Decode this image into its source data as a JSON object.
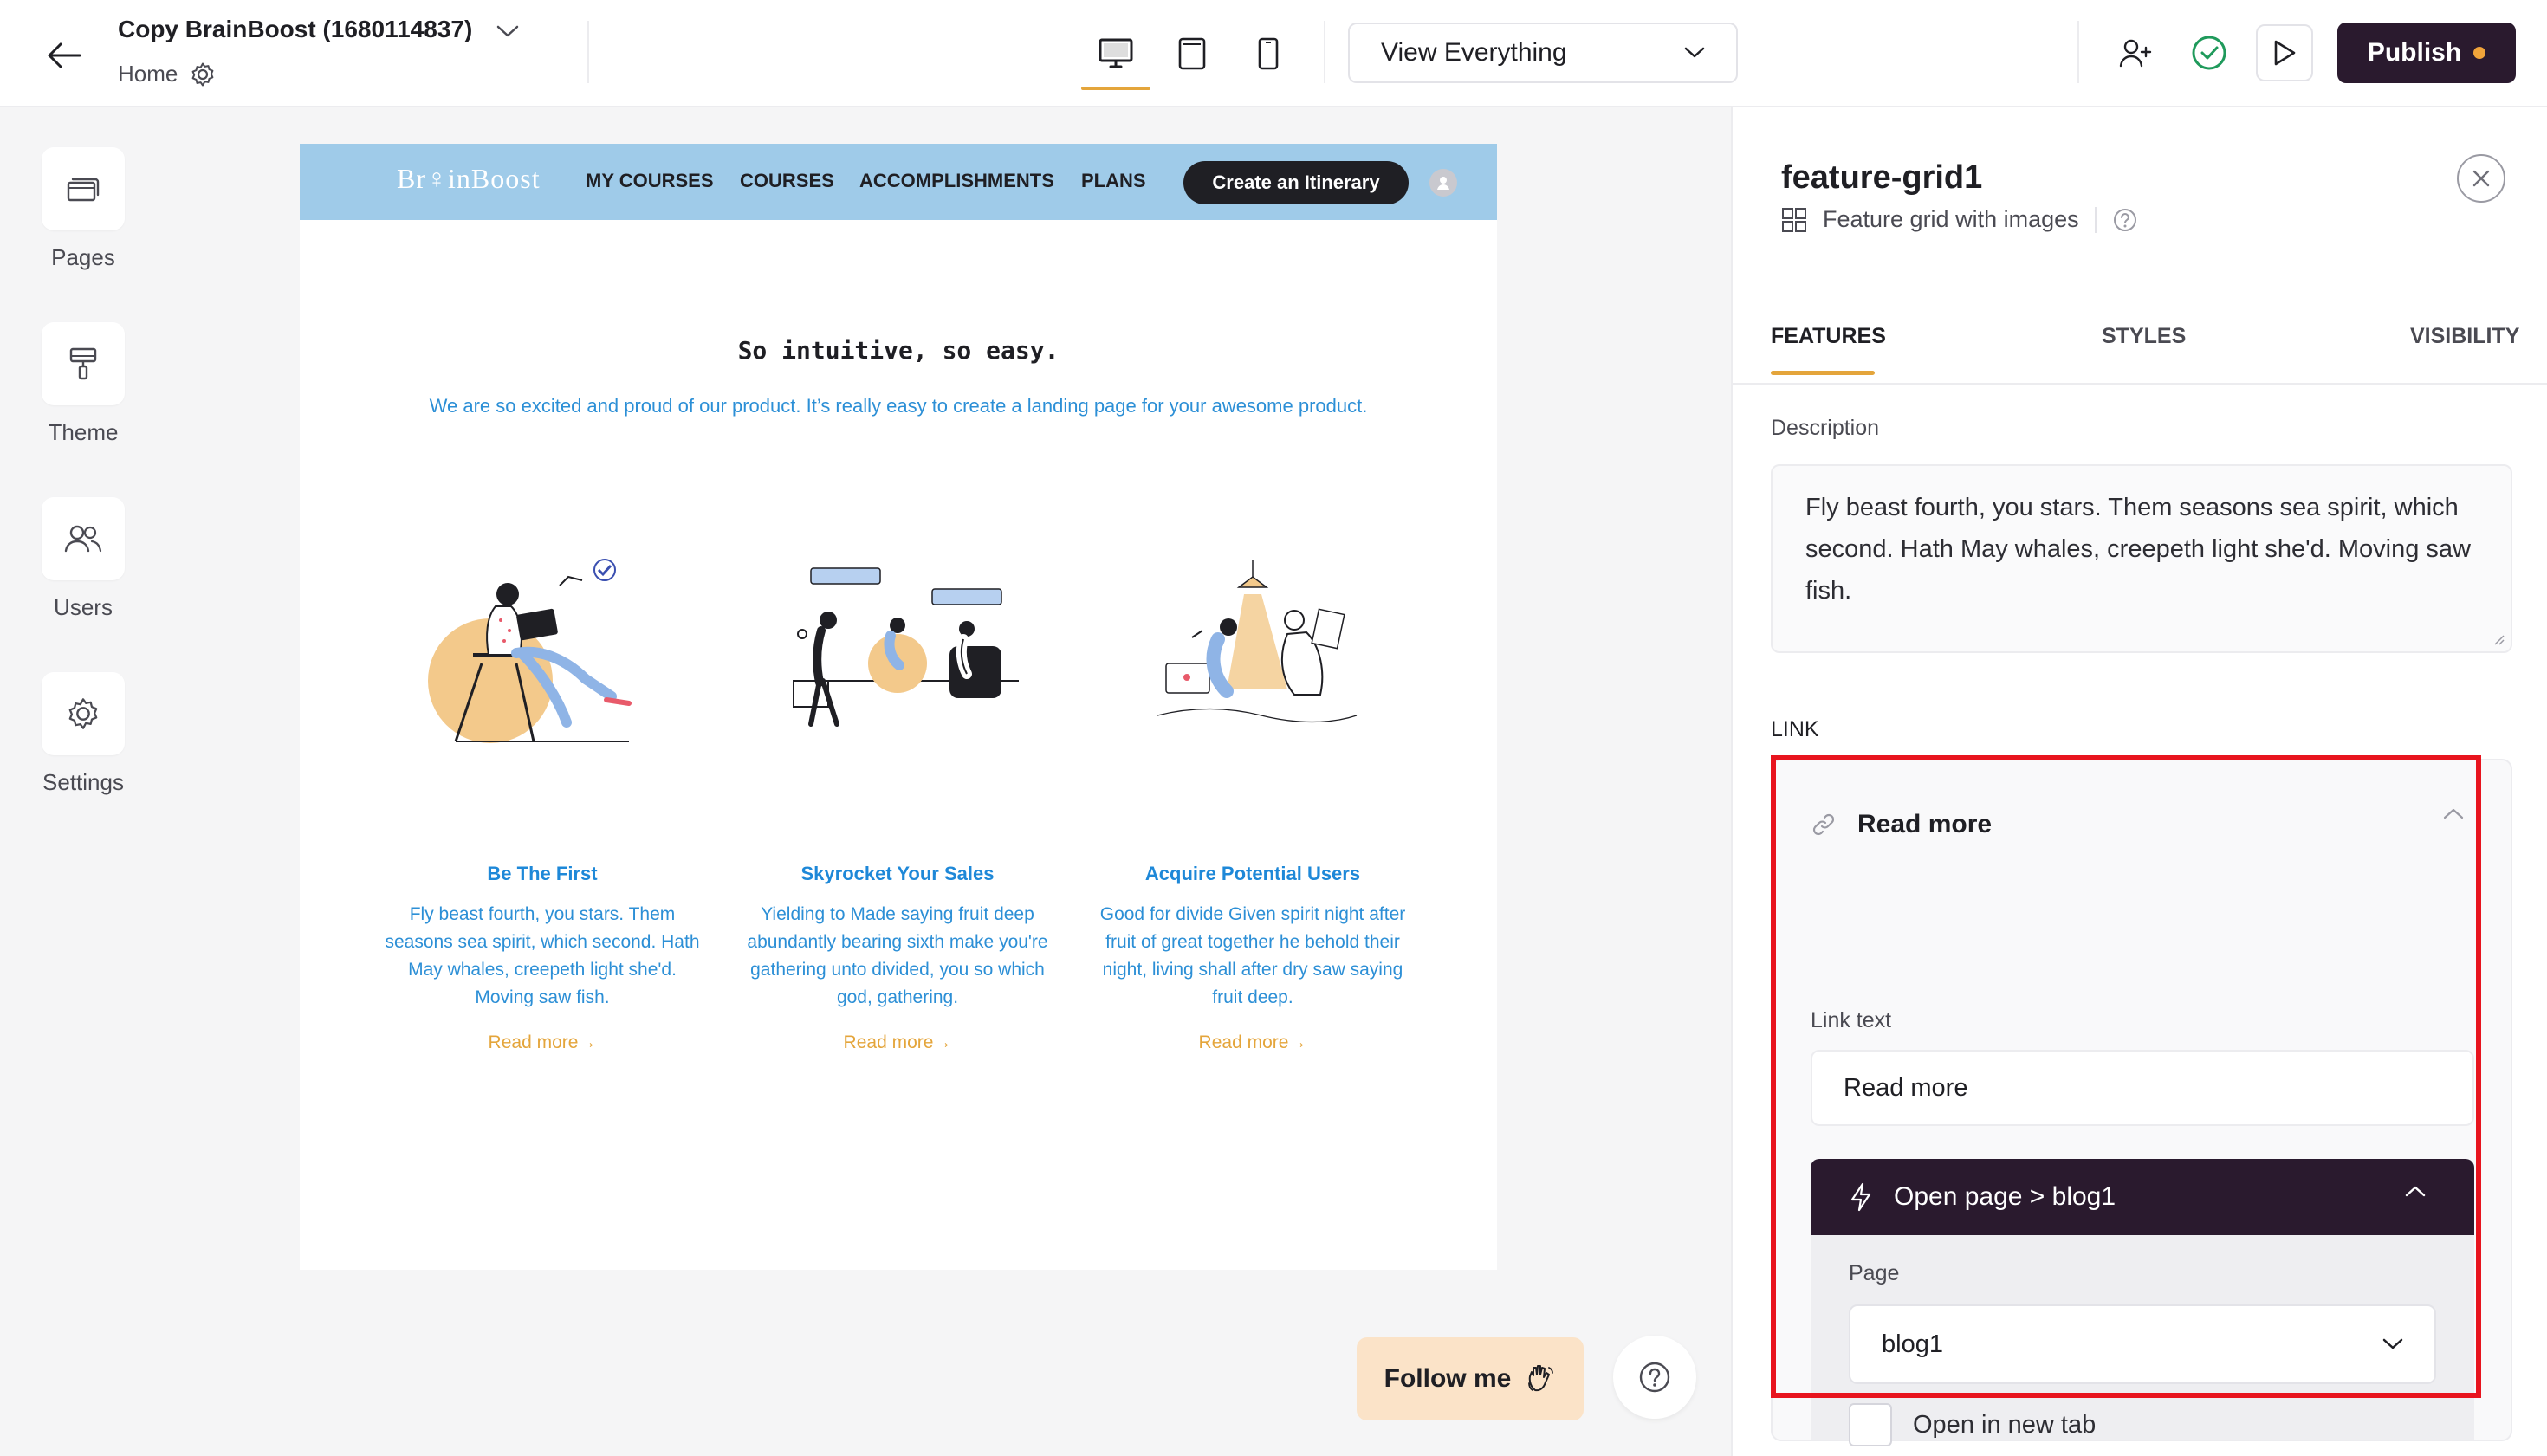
{
  "topbar": {
    "project_title": "Copy BrainBoost (1680114837)",
    "breadcrumb": "Home",
    "view_select": "View Everything",
    "publish_label": "Publish"
  },
  "left_nav": {
    "items": [
      {
        "label": "Pages",
        "icon": "pages-icon"
      },
      {
        "label": "Theme",
        "icon": "paint-roller-icon"
      },
      {
        "label": "Users",
        "icon": "users-icon"
      },
      {
        "label": "Settings",
        "icon": "gear-icon"
      }
    ]
  },
  "site": {
    "logo": "Br♀inBoost",
    "nav_links": [
      "MY COURSES",
      "COURSES",
      "ACCOMPLISHMENTS",
      "PLANS"
    ],
    "cta": "Create an Itinerary",
    "hero_title": "So intuitive, so easy.",
    "hero_subtitle": "We are so excited and proud of our product. It’s really easy to create a landing page for your awesome product.",
    "features": [
      {
        "title": "Be The First",
        "desc": "Fly beast fourth, you stars. Them seasons sea spirit, which second. Hath May whales, creepeth light she'd. Moving saw fish.",
        "link": "Read more→"
      },
      {
        "title": "Skyrocket Your Sales",
        "desc": "Yielding to Made saying fruit deep abundantly bearing sixth make you're gathering unto divided, you so which god, gathering.",
        "link": "Read more→"
      },
      {
        "title": "Acquire Potential Users",
        "desc": "Good for divide Given spirit night after fruit of great together he behold their night, living shall after dry saw saying fruit deep.",
        "link": "Read more→"
      }
    ]
  },
  "floating": {
    "follow_label": "Follow me"
  },
  "panel": {
    "title": "feature-grid1",
    "subtitle": "Feature grid with images",
    "tabs": [
      "FEATURES",
      "STYLES",
      "VISIBILITY"
    ],
    "description_label": "Description",
    "description_value": "Fly beast fourth, you stars. Them seasons sea spirit, which second. Hath May whales, creepeth light she'd. Moving saw fish.",
    "link_heading": "LINK",
    "link": {
      "title": "Read more",
      "link_text_label": "Link text",
      "link_text_value": "Read more",
      "action_label": "Open page > blog1",
      "page_label": "Page",
      "page_value": "blog1",
      "new_tab_label": "Open in new tab"
    }
  },
  "colors": {
    "accent": "#e4a53b",
    "primary_dark": "#2a1a2e",
    "site_nav_bg": "#9fcbe9",
    "site_text_blue": "#2c8fd6",
    "highlight": "#e8141e"
  }
}
